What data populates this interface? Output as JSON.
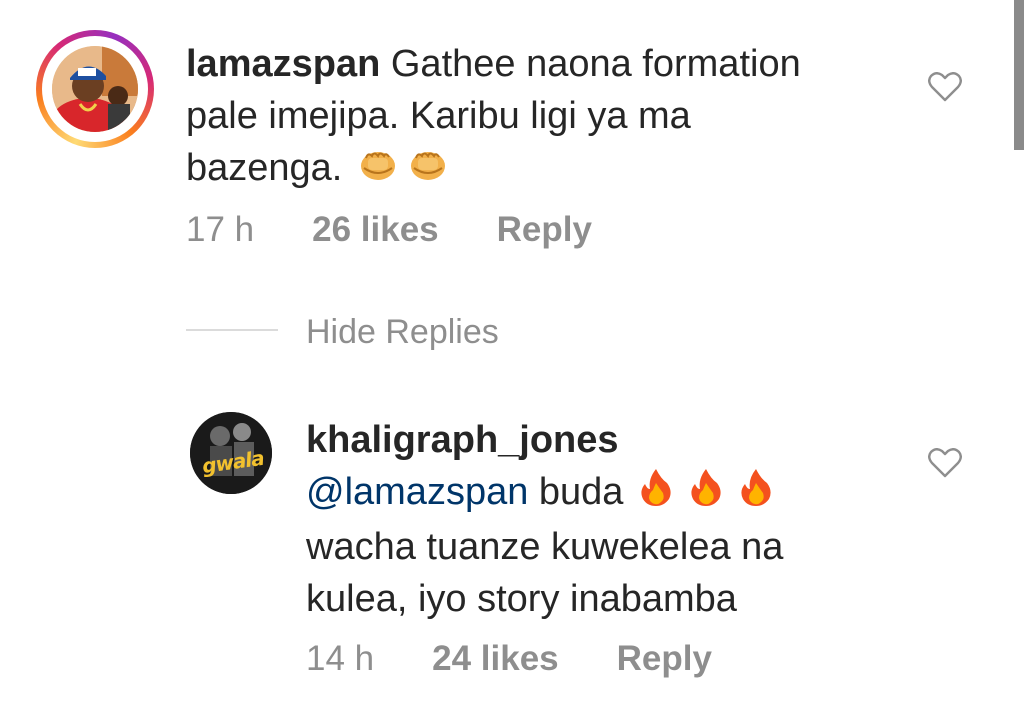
{
  "comments": [
    {
      "username": "lamazspan",
      "text_line1": "Gathee naona formation",
      "text_line2": "pale imejipa.  Karibu ligi ya ma",
      "text_line3": "bazenga.",
      "emojis": [
        "fist-bump-emoji",
        "fist-bump-emoji"
      ],
      "time": "17 h",
      "likes": "26 likes",
      "reply_label": "Reply"
    },
    {
      "username": "khaligraph_jones",
      "mention": "@lamazspan",
      "text_line1": "buda",
      "emojis": [
        "fire-emoji",
        "fire-emoji",
        "fire-emoji"
      ],
      "text_line2": "wacha tuanze kuwekelea na",
      "text_line3": "kulea, iyo story inabamba",
      "avatar_text": "gwala",
      "time": "14 h",
      "likes": "24 likes",
      "reply_label": "Reply"
    }
  ],
  "hide_replies_label": "Hide Replies",
  "colors": {
    "text": "#262626",
    "meta": "#8e8e8e",
    "mention": "#003569",
    "divider": "#dbdbdb"
  }
}
